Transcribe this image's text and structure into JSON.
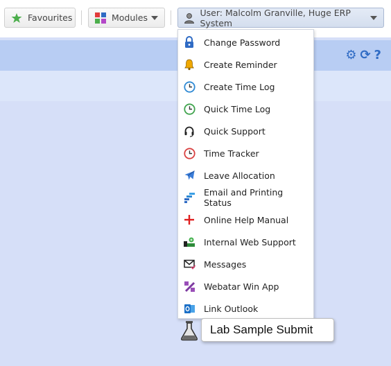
{
  "toolbar": {
    "favourites_label": "Favourites",
    "modules_label": "Modules",
    "user_label": "User: Malcolm Granville, Huge ERP System"
  },
  "header_icons": {
    "settings": "⚙",
    "refresh": "⟳",
    "help": "?"
  },
  "user_menu": {
    "items": [
      {
        "label": "Change Password",
        "icon": "lock-icon"
      },
      {
        "label": "Create Reminder",
        "icon": "bell-icon"
      },
      {
        "label": "Create Time Log",
        "icon": "clock-icon"
      },
      {
        "label": "Quick Time Log",
        "icon": "clock-icon"
      },
      {
        "label": "Quick Support",
        "icon": "headset-icon"
      },
      {
        "label": "Time Tracker",
        "icon": "clock-icon"
      },
      {
        "label": "Leave Allocation",
        "icon": "airplane-icon"
      },
      {
        "label": "Email and Printing Status",
        "icon": "status-icon"
      },
      {
        "label": "Online Help Manual",
        "icon": "plus-icon"
      },
      {
        "label": "Internal Web Support",
        "icon": "web-support-icon"
      },
      {
        "label": "Messages",
        "icon": "envelope-icon"
      },
      {
        "label": "Webatar Win App",
        "icon": "app-icon"
      },
      {
        "label": "Link Outlook",
        "icon": "outlook-icon"
      }
    ]
  },
  "tooltip": {
    "text": "Lab Sample Submit"
  },
  "colors": {
    "accent": "#2f6bc4",
    "page_background": "#d6dff8",
    "header_band": "#b8cdf3"
  }
}
